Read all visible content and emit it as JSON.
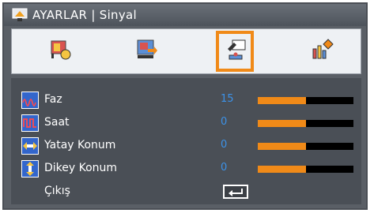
{
  "title": "AYARLAR | Sinyal",
  "tabs": [
    {
      "icon": "image-settings-icon",
      "selected": false
    },
    {
      "icon": "display-settings-icon",
      "selected": false
    },
    {
      "icon": "settings-tools-icon",
      "selected": true
    },
    {
      "icon": "info-icon",
      "selected": false
    }
  ],
  "rows": [
    {
      "label": "Faz",
      "value": "15",
      "level": 0.5,
      "icon": "phase-icon"
    },
    {
      "label": "Saat",
      "value": "0",
      "level": 0.5,
      "icon": "clock-icon"
    },
    {
      "label": "Yatay Konum",
      "value": "0",
      "level": 0.5,
      "icon": "horizontal-position-icon"
    },
    {
      "label": "Dikey Konum",
      "value": "0",
      "level": 0.5,
      "icon": "vertical-position-icon"
    }
  ],
  "exit": {
    "label": "Çıkış",
    "icon": "enter-key-icon"
  },
  "colors": {
    "accent": "#f08a18",
    "value": "#3c92e8",
    "panel": "#4a4f56",
    "background": "#5a5f66"
  }
}
